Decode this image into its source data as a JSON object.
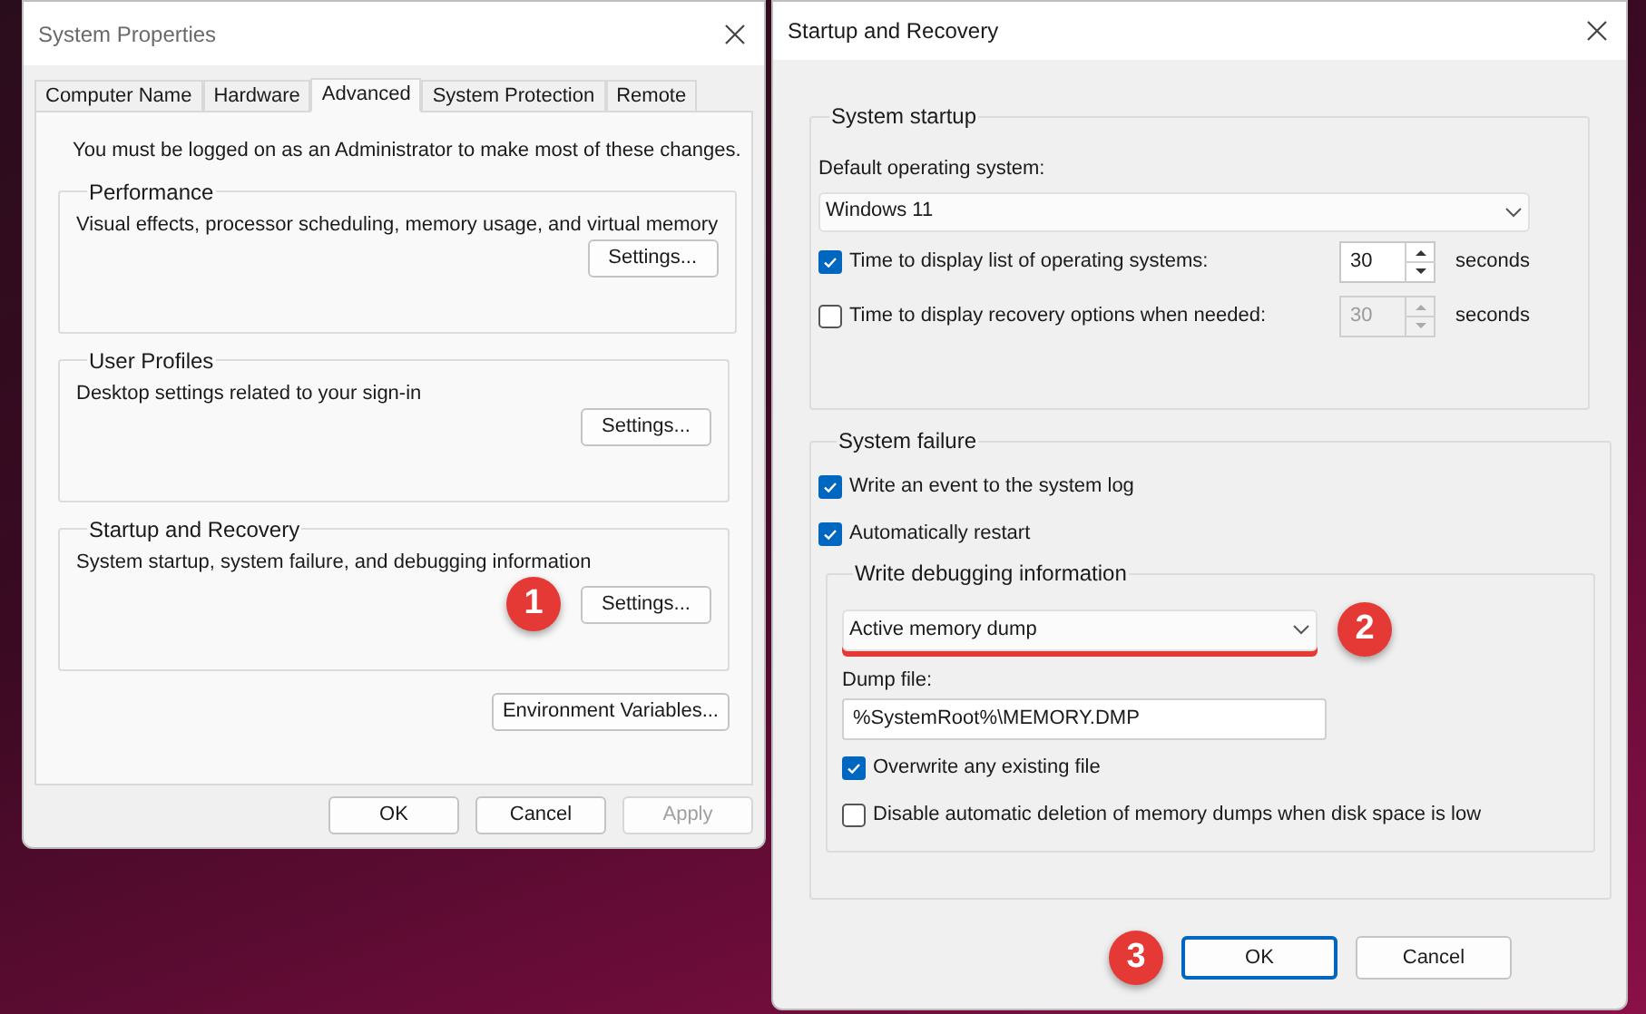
{
  "system_properties": {
    "title": "System Properties",
    "tabs": [
      {
        "label": "Computer Name",
        "selected": false
      },
      {
        "label": "Hardware",
        "selected": false
      },
      {
        "label": "Advanced",
        "selected": true
      },
      {
        "label": "System Protection",
        "selected": false
      },
      {
        "label": "Remote",
        "selected": false
      }
    ],
    "notice": "You must be logged on as an Administrator to make most of these changes.",
    "groups": [
      {
        "title": "Performance",
        "description": "Visual effects, processor scheduling, memory usage, and virtual memory",
        "button": "Settings..."
      },
      {
        "title": "User Profiles",
        "description": "Desktop settings related to your sign-in",
        "button": "Settings..."
      },
      {
        "title": "Startup and Recovery",
        "description": "System startup, system failure, and debugging information",
        "button": "Settings...",
        "marker": "1"
      }
    ],
    "environment_button": "Environment Variables...",
    "buttons": [
      {
        "label": "OK",
        "disabled": false
      },
      {
        "label": "Cancel",
        "disabled": false
      },
      {
        "label": "Apply",
        "disabled": true
      }
    ]
  },
  "startup_recovery": {
    "title": "Startup and Recovery",
    "system_startup": {
      "title": "System startup",
      "default_os_label": "Default operating system:",
      "default_os_value": "Windows 11",
      "options": [
        {
          "label": "Time to display list of operating systems:",
          "checked": true,
          "value": "30",
          "unit": "seconds"
        },
        {
          "label": "Time to display recovery options when needed:",
          "checked": false,
          "value": "30",
          "unit": "seconds"
        }
      ]
    },
    "system_failure": {
      "title": "System failure",
      "options": [
        {
          "label": "Write an event to the system log",
          "checked": true
        },
        {
          "label": "Automatically restart",
          "checked": true
        }
      ],
      "debugging": {
        "title": "Write debugging information",
        "dump_type": "Active memory dump",
        "highlighted": true,
        "marker": "2",
        "dump_file_label": "Dump file:",
        "dump_file_value": "%SystemRoot%\\MEMORY.DMP",
        "options": [
          {
            "label": "Overwrite any existing file",
            "checked": true
          },
          {
            "label": "Disable automatic deletion of memory dumps when disk space is low",
            "checked": false
          }
        ]
      }
    },
    "buttons": [
      {
        "label": "OK",
        "default": true,
        "marker": "3"
      },
      {
        "label": "Cancel",
        "default": false
      }
    ]
  }
}
